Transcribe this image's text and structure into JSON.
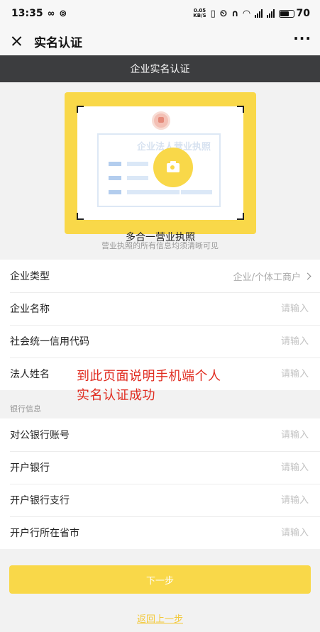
{
  "status_bar": {
    "time": "13:35",
    "icons_left": [
      "infinity-icon",
      "app-notification-icon"
    ],
    "net_speed_top": "0.05",
    "net_speed_bottom": "KB/S",
    "battery_level": "70"
  },
  "title_bar": {
    "title": "实名认证",
    "more_label": "···"
  },
  "header": {
    "title": "企业实名认证"
  },
  "upload": {
    "license_watermark": "企业法人营业执照",
    "card_caption": "多合一营业执照",
    "hint": "营业执照的所有信息均须清晰可见"
  },
  "company_form": {
    "rows": [
      {
        "label": "企业类型",
        "value": "企业/个体工商户"
      },
      {
        "label": "企业名称",
        "placeholder": "请输入"
      },
      {
        "label": "社会统一信用代码",
        "placeholder": "请输入"
      },
      {
        "label": "法人姓名",
        "placeholder": "请输入"
      }
    ]
  },
  "bank_section": {
    "caption": "银行信息",
    "rows": [
      {
        "label": "对公银行账号",
        "placeholder": "请输入"
      },
      {
        "label": "开户银行",
        "placeholder": "请输入"
      },
      {
        "label": "开户银行支行",
        "placeholder": "请输入"
      },
      {
        "label": "开户行所在省市",
        "placeholder": "请输入"
      }
    ]
  },
  "annotation": {
    "line1": "到此页面说明手机端个人",
    "line2": "实名认证成功"
  },
  "actions": {
    "next_label": "下一步",
    "back_label": "返回上一步"
  },
  "colors": {
    "accent": "#f9d849",
    "header_bg": "#3c3d3f",
    "annotation": "#e02b1f"
  }
}
